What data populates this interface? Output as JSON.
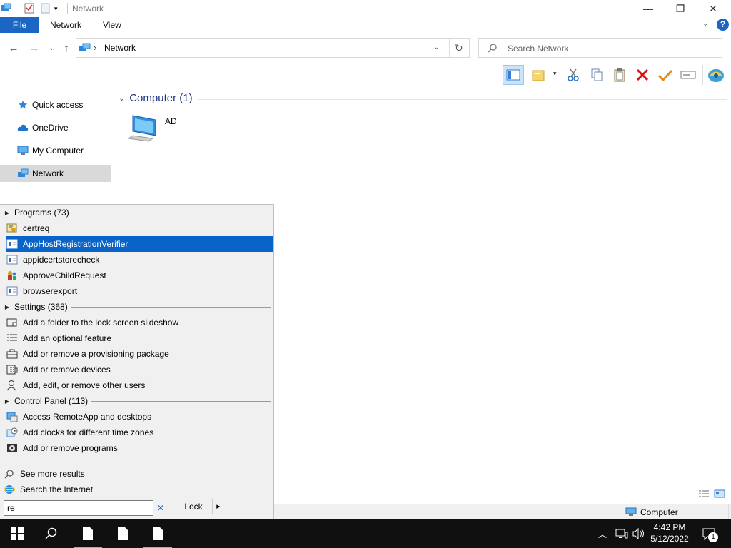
{
  "window": {
    "title": "Network",
    "minimize": "—",
    "restore": "❐",
    "close": "✕"
  },
  "ribbon": {
    "tabs": [
      "File",
      "Network",
      "View"
    ]
  },
  "address": {
    "separator": "›",
    "location": "Network",
    "search_placeholder": "Search Network"
  },
  "nav_pane": {
    "items": [
      {
        "label": "Quick access",
        "icon": "star-icon"
      },
      {
        "label": "OneDrive",
        "icon": "cloud-icon"
      },
      {
        "label": "My Computer",
        "icon": "computer-icon"
      },
      {
        "label": "Network",
        "icon": "network-icon"
      }
    ]
  },
  "content": {
    "group_title": "Computer (1)",
    "items": [
      {
        "label": "AD",
        "icon": "computer-icon"
      }
    ]
  },
  "search_panel": {
    "programs": {
      "header": "Programs (73)",
      "items": [
        "certreq",
        "AppHostRegistrationVerifier",
        "appidcertstorecheck",
        "ApproveChildRequest",
        "browserexport"
      ],
      "selected_index": 1
    },
    "settings": {
      "header": "Settings (368)",
      "items": [
        "Add a folder to the lock screen slideshow",
        "Add an optional feature",
        "Add or remove a provisioning package",
        "Add or remove devices",
        "Add, edit, or remove other users"
      ]
    },
    "control_panel": {
      "header": "Control Panel (113)",
      "items": [
        "Access RemoteApp and desktops",
        "Add clocks for different time zones",
        "Add or remove programs"
      ]
    },
    "see_more": "See more results",
    "search_internet": "Search the Internet",
    "query": "re",
    "clear": "✕",
    "lock_button": "Lock",
    "lock_arrow": "▸"
  },
  "status_bar": {
    "computer_label": "Computer"
  },
  "taskbar": {
    "time": "4:42 PM",
    "date": "5/12/2022",
    "notification_count": "1"
  },
  "colors": {
    "accent": "#0a64c8",
    "file_tab": "#1a66c2",
    "taskbar": "#101010",
    "panel": "#f0f0f0"
  }
}
